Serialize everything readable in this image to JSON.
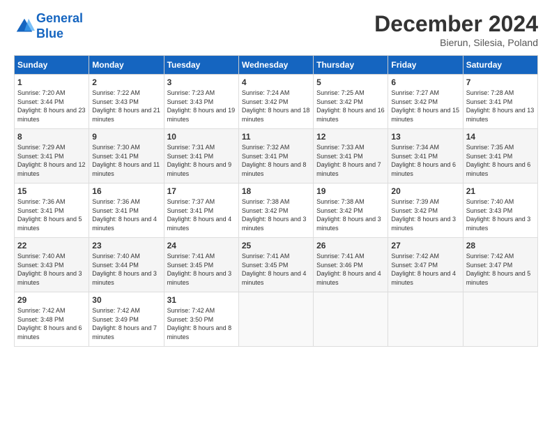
{
  "header": {
    "logo_line1": "General",
    "logo_line2": "Blue",
    "month_title": "December 2024",
    "location": "Bierun, Silesia, Poland"
  },
  "days_of_week": [
    "Sunday",
    "Monday",
    "Tuesday",
    "Wednesday",
    "Thursday",
    "Friday",
    "Saturday"
  ],
  "weeks": [
    [
      {
        "day": "1",
        "sunrise": "7:20 AM",
        "sunset": "3:44 PM",
        "daylight": "8 hours and 23 minutes."
      },
      {
        "day": "2",
        "sunrise": "7:22 AM",
        "sunset": "3:43 PM",
        "daylight": "8 hours and 21 minutes."
      },
      {
        "day": "3",
        "sunrise": "7:23 AM",
        "sunset": "3:43 PM",
        "daylight": "8 hours and 19 minutes."
      },
      {
        "day": "4",
        "sunrise": "7:24 AM",
        "sunset": "3:42 PM",
        "daylight": "8 hours and 18 minutes."
      },
      {
        "day": "5",
        "sunrise": "7:25 AM",
        "sunset": "3:42 PM",
        "daylight": "8 hours and 16 minutes."
      },
      {
        "day": "6",
        "sunrise": "7:27 AM",
        "sunset": "3:42 PM",
        "daylight": "8 hours and 15 minutes."
      },
      {
        "day": "7",
        "sunrise": "7:28 AM",
        "sunset": "3:41 PM",
        "daylight": "8 hours and 13 minutes."
      }
    ],
    [
      {
        "day": "8",
        "sunrise": "7:29 AM",
        "sunset": "3:41 PM",
        "daylight": "8 hours and 12 minutes."
      },
      {
        "day": "9",
        "sunrise": "7:30 AM",
        "sunset": "3:41 PM",
        "daylight": "8 hours and 11 minutes."
      },
      {
        "day": "10",
        "sunrise": "7:31 AM",
        "sunset": "3:41 PM",
        "daylight": "8 hours and 9 minutes."
      },
      {
        "day": "11",
        "sunrise": "7:32 AM",
        "sunset": "3:41 PM",
        "daylight": "8 hours and 8 minutes."
      },
      {
        "day": "12",
        "sunrise": "7:33 AM",
        "sunset": "3:41 PM",
        "daylight": "8 hours and 7 minutes."
      },
      {
        "day": "13",
        "sunrise": "7:34 AM",
        "sunset": "3:41 PM",
        "daylight": "8 hours and 6 minutes."
      },
      {
        "day": "14",
        "sunrise": "7:35 AM",
        "sunset": "3:41 PM",
        "daylight": "8 hours and 6 minutes."
      }
    ],
    [
      {
        "day": "15",
        "sunrise": "7:36 AM",
        "sunset": "3:41 PM",
        "daylight": "8 hours and 5 minutes."
      },
      {
        "day": "16",
        "sunrise": "7:36 AM",
        "sunset": "3:41 PM",
        "daylight": "8 hours and 4 minutes."
      },
      {
        "day": "17",
        "sunrise": "7:37 AM",
        "sunset": "3:41 PM",
        "daylight": "8 hours and 4 minutes."
      },
      {
        "day": "18",
        "sunrise": "7:38 AM",
        "sunset": "3:42 PM",
        "daylight": "8 hours and 3 minutes."
      },
      {
        "day": "19",
        "sunrise": "7:38 AM",
        "sunset": "3:42 PM",
        "daylight": "8 hours and 3 minutes."
      },
      {
        "day": "20",
        "sunrise": "7:39 AM",
        "sunset": "3:42 PM",
        "daylight": "8 hours and 3 minutes."
      },
      {
        "day": "21",
        "sunrise": "7:40 AM",
        "sunset": "3:43 PM",
        "daylight": "8 hours and 3 minutes."
      }
    ],
    [
      {
        "day": "22",
        "sunrise": "7:40 AM",
        "sunset": "3:43 PM",
        "daylight": "8 hours and 3 minutes."
      },
      {
        "day": "23",
        "sunrise": "7:40 AM",
        "sunset": "3:44 PM",
        "daylight": "8 hours and 3 minutes."
      },
      {
        "day": "24",
        "sunrise": "7:41 AM",
        "sunset": "3:45 PM",
        "daylight": "8 hours and 3 minutes."
      },
      {
        "day": "25",
        "sunrise": "7:41 AM",
        "sunset": "3:45 PM",
        "daylight": "8 hours and 4 minutes."
      },
      {
        "day": "26",
        "sunrise": "7:41 AM",
        "sunset": "3:46 PM",
        "daylight": "8 hours and 4 minutes."
      },
      {
        "day": "27",
        "sunrise": "7:42 AM",
        "sunset": "3:47 PM",
        "daylight": "8 hours and 4 minutes."
      },
      {
        "day": "28",
        "sunrise": "7:42 AM",
        "sunset": "3:47 PM",
        "daylight": "8 hours and 5 minutes."
      }
    ],
    [
      {
        "day": "29",
        "sunrise": "7:42 AM",
        "sunset": "3:48 PM",
        "daylight": "8 hours and 6 minutes."
      },
      {
        "day": "30",
        "sunrise": "7:42 AM",
        "sunset": "3:49 PM",
        "daylight": "8 hours and 7 minutes."
      },
      {
        "day": "31",
        "sunrise": "7:42 AM",
        "sunset": "3:50 PM",
        "daylight": "8 hours and 8 minutes."
      },
      null,
      null,
      null,
      null
    ]
  ]
}
